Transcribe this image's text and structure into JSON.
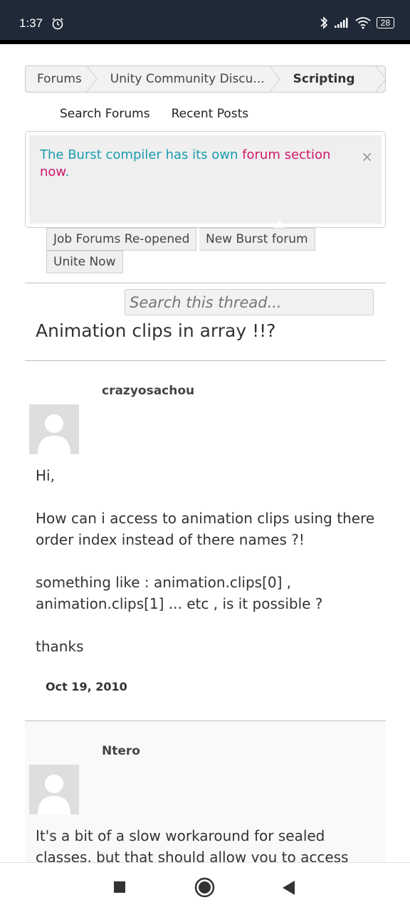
{
  "status_bar": {
    "time": "1:37",
    "battery": "28"
  },
  "breadcrumb": [
    "Forums",
    "Unity Community Discu...",
    "Scripting"
  ],
  "subnav": {
    "search": "Search Forums",
    "recent": "Recent Posts"
  },
  "notice": {
    "text_part1": "The Burst compiler has its own ",
    "link_text": "forum section now",
    "text_end": ".",
    "close": "×",
    "colors": {
      "text": "#1a9bb0",
      "link": "#d0176a"
    }
  },
  "tags": [
    "Job Forums Re-opened",
    "New Burst forum",
    "Unite Now"
  ],
  "search": {
    "placeholder": "Search this thread..."
  },
  "thread": {
    "title": "Animation clips in array !!?"
  },
  "posts": [
    {
      "author": "crazyosachou",
      "paragraphs": [
        "Hi,",
        "How can i access to animation clips using there order index instead of there names ?!",
        "something like : animation.clips[0] , animation.clips[1] ... etc , is it possible ?",
        "thanks"
      ],
      "date": "Oct 19, 2010"
    },
    {
      "author": "Ntero",
      "paragraphs": [
        "It's a bit of a slow workaround for sealed classes, but that should allow you to access"
      ]
    }
  ],
  "nav": {
    "recents_icon": "square-icon",
    "home_icon": "circle-icon",
    "back_icon": "triangle-back-icon"
  }
}
